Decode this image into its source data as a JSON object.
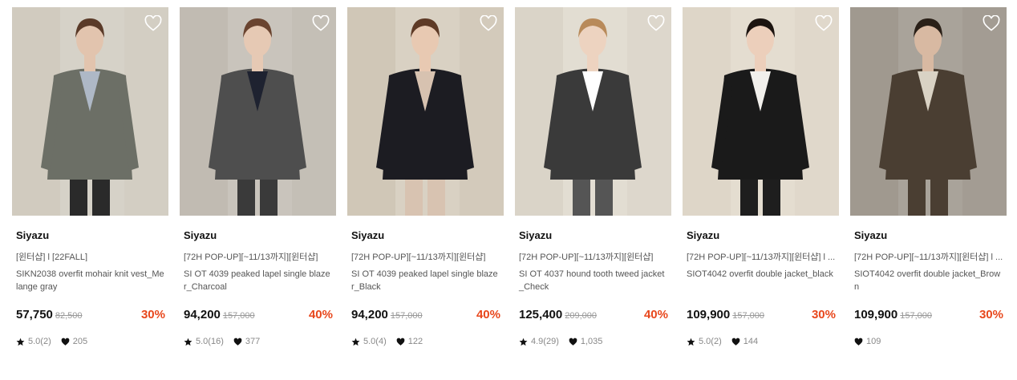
{
  "colors": {
    "discount": "#e8471c",
    "strike": "#999999",
    "text": "#111111"
  },
  "products": [
    {
      "brand": "Siyazu",
      "tag": "[윈터샵] l [22FALL]",
      "name": "SIKN2038 overfit mohair knit vest_Melange gray",
      "price": "57,750",
      "original_price": "82,500",
      "discount": "30%",
      "rating": "5.0(2)",
      "likes": "205",
      "photo": {
        "bg": "#d6d2c8",
        "wall": "#cfc9bd",
        "top": "#6c6f66",
        "shirt": "#aeb8c6",
        "skin": "#e2c4ae",
        "hair": "#5a3a28",
        "pants": "#2a2a2a"
      }
    },
    {
      "brand": "Siyazu",
      "tag": "[72H POP-UP][~11/13까지][윈터샵]",
      "name": "SI OT 4039 peaked lapel single blazer_Charcoal",
      "price": "94,200",
      "original_price": "157,000",
      "discount": "40%",
      "rating": "5.0(16)",
      "likes": "377",
      "photo": {
        "bg": "#c9c4bc",
        "wall": "#bfb9af",
        "top": "#4e4e4e",
        "shirt": "#1e2230",
        "skin": "#e6c9b4",
        "hair": "#6a4430",
        "pants": "#3a3a3a"
      }
    },
    {
      "brand": "Siyazu",
      "tag": "[72H POP-UP][~11/13까지][윈터샵]",
      "name": "SI OT 4039 peaked lapel single blazer_Black",
      "price": "94,200",
      "original_price": "157,000",
      "discount": "40%",
      "rating": "5.0(4)",
      "likes": "122",
      "photo": {
        "bg": "#d9d1c3",
        "wall": "#cdc4b4",
        "top": "#1c1c22",
        "shirt": "#d7c2b0",
        "skin": "#e8c9b2",
        "hair": "#5e3a26",
        "pants": "#d8c3b1"
      }
    },
    {
      "brand": "Siyazu",
      "tag": "[72H POP-UP][~11/13까지][윈터샵]",
      "name": "SI OT 4037 hound tooth tweed jacket_Check",
      "price": "125,400",
      "original_price": "209,000",
      "discount": "40%",
      "rating": "4.9(29)",
      "likes": "1,035",
      "photo": {
        "bg": "#e2ddd2",
        "wall": "#d8d2c6",
        "top": "#3a3a3a",
        "shirt": "#ffffff",
        "skin": "#edd3c0",
        "hair": "#b88a5a",
        "pants": "#555555"
      }
    },
    {
      "brand": "Siyazu",
      "tag": "[72H POP-UP][~11/13까지][윈터샵] l ...",
      "name": "SIOT4042 overfit double jacket_black",
      "price": "109,900",
      "original_price": "157,000",
      "discount": "30%",
      "rating": "5.0(2)",
      "likes": "144",
      "photo": {
        "bg": "#e4ddd0",
        "wall": "#dcd4c6",
        "top": "#1a1a1a",
        "shirt": "#f2f0ec",
        "skin": "#eccfbb",
        "hair": "#1c1410",
        "pants": "#1e1e1e"
      }
    },
    {
      "brand": "Siyazu",
      "tag": "[72H POP-UP][~11/13까지][윈터샵] l ...",
      "name": "SIOT4042 overfit double jacket_Brown",
      "price": "109,900",
      "original_price": "157,000",
      "discount": "30%",
      "rating": "",
      "likes": "109",
      "photo": {
        "bg": "#a9a39a",
        "wall": "#9d968c",
        "top": "#4a3e32",
        "shirt": "#d9d2c4",
        "skin": "#d8b9a2",
        "hair": "#2a2018",
        "pants": "#4a3e32"
      }
    }
  ]
}
